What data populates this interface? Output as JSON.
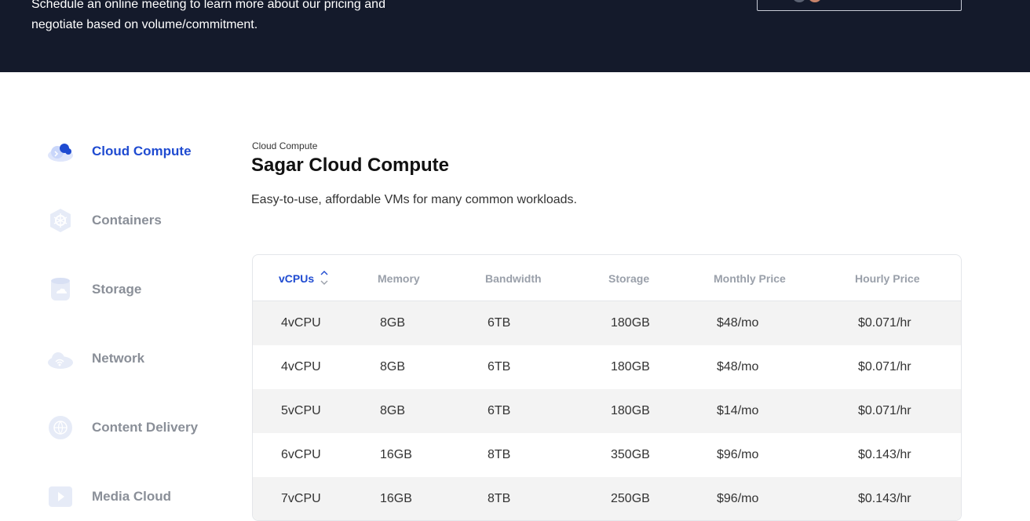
{
  "banner": {
    "text_line1": "Schedule an online meeting to learn more about our pricing and",
    "text_line2": "negotiate based on volume/commitment."
  },
  "sidebar": {
    "items": [
      {
        "label": "Cloud Compute",
        "icon": "cloud-compute-icon",
        "active": true
      },
      {
        "label": "Containers",
        "icon": "containers-icon",
        "active": false
      },
      {
        "label": "Storage",
        "icon": "storage-icon",
        "active": false
      },
      {
        "label": "Network",
        "icon": "network-icon",
        "active": false
      },
      {
        "label": "Content Delivery",
        "icon": "content-delivery-icon",
        "active": false
      },
      {
        "label": "Media Cloud",
        "icon": "media-cloud-icon",
        "active": false
      }
    ]
  },
  "main": {
    "breadcrumb": "Cloud Compute",
    "title": "Sagar Cloud Compute",
    "description": "Easy-to-use, affordable VMs for many common workloads."
  },
  "table": {
    "columns": [
      "vCPUs",
      "Memory",
      "Bandwidth",
      "Storage",
      "Monthly Price",
      "Hourly Price"
    ],
    "rows": [
      [
        "4vCPU",
        "8GB",
        "6TB",
        "180GB",
        "$48/mo",
        "$0.071/hr"
      ],
      [
        "4vCPU",
        "8GB",
        "6TB",
        "180GB",
        "$48/mo",
        "$0.071/hr"
      ],
      [
        "5vCPU",
        "8GB",
        "6TB",
        "180GB",
        "$14/mo",
        "$0.071/hr"
      ],
      [
        "6vCPU",
        "16GB",
        "8TB",
        "350GB",
        "$96/mo",
        "$0.143/hr"
      ],
      [
        "7vCPU",
        "16GB",
        "8TB",
        "250GB",
        "$96/mo",
        "$0.143/hr"
      ]
    ]
  },
  "colors": {
    "banner_bg": "#141a2b",
    "accent": "#1f4bd1",
    "row_shade": "#f3f3f3"
  }
}
